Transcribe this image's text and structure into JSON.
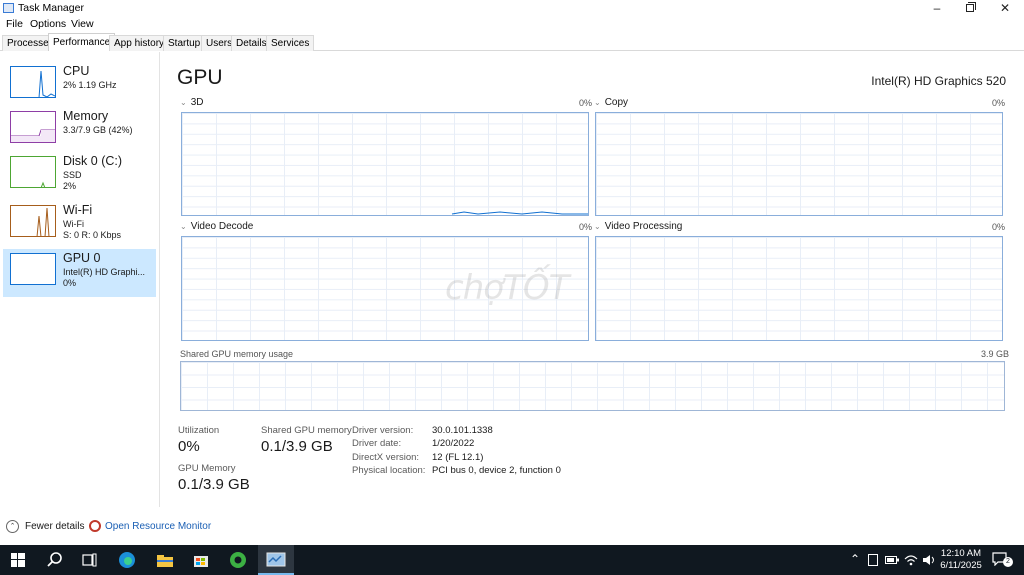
{
  "window": {
    "title": "Task Manager"
  },
  "menu": [
    "File",
    "Options",
    "View"
  ],
  "tabs": [
    "Processes",
    "Performance",
    "App history",
    "Startup",
    "Users",
    "Details",
    "Services"
  ],
  "sidebar": [
    {
      "title": "CPU",
      "line1": "2%  1.19 GHz",
      "line2": "",
      "color": "#1170d1"
    },
    {
      "title": "Memory",
      "line1": "3.3/7.9 GB (42%)",
      "line2": "",
      "color": "#8e3ea6"
    },
    {
      "title": "Disk 0 (C:)",
      "line1": "SSD",
      "line2": "2%",
      "color": "#4da633"
    },
    {
      "title": "Wi-Fi",
      "line1": "Wi-Fi",
      "line2": "S: 0  R: 0 Kbps",
      "color": "#a65d1b"
    },
    {
      "title": "GPU 0",
      "line1": "Intel(R) HD Graphi...",
      "line2": "0%",
      "color": "#1170d1"
    }
  ],
  "main": {
    "title": "GPU",
    "adapter": "Intel(R) HD Graphics 520",
    "graphs": [
      {
        "label": "3D",
        "pct": "0%"
      },
      {
        "label": "Copy",
        "pct": "0%"
      },
      {
        "label": "Video Decode",
        "pct": "0%"
      },
      {
        "label": "Video Processing",
        "pct": "0%"
      }
    ],
    "shared_label": "Shared GPU memory usage",
    "shared_max": "3.9 GB",
    "watermark": "chợTỐT"
  },
  "stats": {
    "utilization_label": "Utilization",
    "utilization_value": "0%",
    "shared_label": "Shared GPU memory",
    "shared_value": "0.1/3.9 GB",
    "gpu_mem_label": "GPU Memory",
    "gpu_mem_value": "0.1/3.9 GB"
  },
  "info": [
    {
      "label": "Driver version:",
      "value": "30.0.101.1338"
    },
    {
      "label": "Driver date:",
      "value": "1/20/2022"
    },
    {
      "label": "DirectX version:",
      "value": "12 (FL 12.1)"
    },
    {
      "label": "Physical location:",
      "value": "PCI bus 0, device 2, function 0"
    }
  ],
  "footer": {
    "fewer_details": "Fewer details",
    "open_monitor": "Open Resource Monitor"
  },
  "taskbar": {
    "time": "12:10 AM",
    "date": "6/11/2025",
    "notifications": "2"
  }
}
